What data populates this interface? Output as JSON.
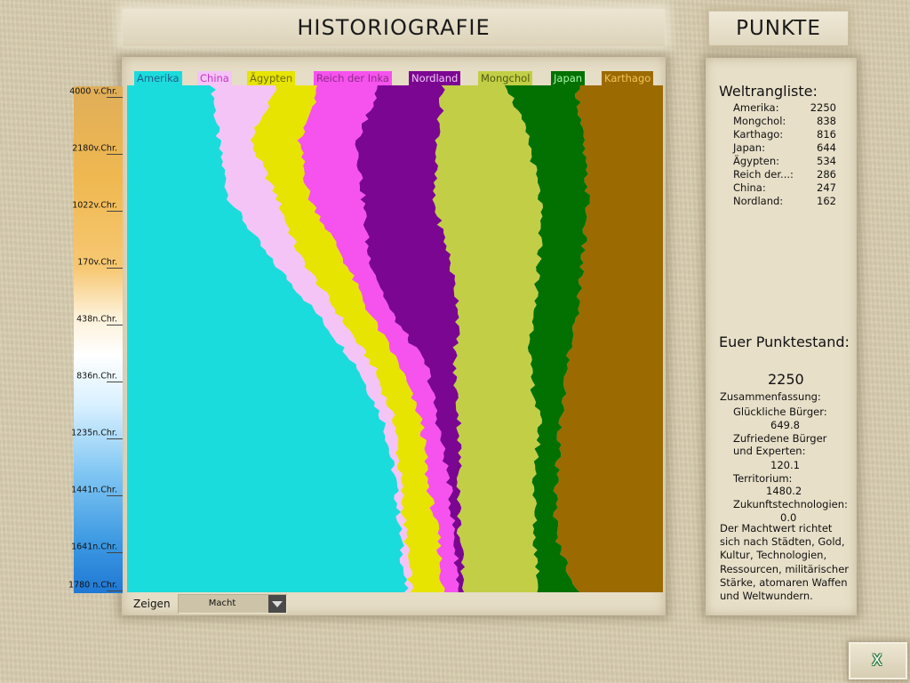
{
  "header": {
    "title": "HISTORIOGRAFIE",
    "tab_label": "PUNKTE"
  },
  "timeline": {
    "labels": [
      "4000 v.Chr.",
      "2180v.Chr.",
      "1022v.Chr.",
      "170v.Chr.",
      "438n.Chr.",
      "836n.Chr.",
      "1235n.Chr.",
      "1441n.Chr.",
      "1641n.Chr.",
      "1780 n.Chr."
    ]
  },
  "chart_data": {
    "type": "area",
    "stacked": "normalized",
    "x_axis_orientation": "vertical, time runs top to bottom",
    "time_labels": [
      "4000 v.Chr.",
      "2180v.Chr.",
      "1022v.Chr.",
      "170v.Chr.",
      "438n.Chr.",
      "836n.Chr.",
      "1235n.Chr.",
      "1441n.Chr.",
      "1641n.Chr.",
      "1780 n.Chr."
    ],
    "series": [
      {
        "name": "Amerika",
        "color": "#1bdcdc",
        "boundary_right": [
          0.16,
          0.17,
          0.19,
          0.26,
          0.35,
          0.43,
          0.48,
          0.5,
          0.51,
          0.52
        ]
      },
      {
        "name": "China",
        "color": "#f4c4f7",
        "boundary_right": [
          0.28,
          0.23,
          0.28,
          0.32,
          0.39,
          0.46,
          0.5,
          0.51,
          0.52,
          0.53
        ]
      },
      {
        "name": "Ägypten",
        "color": "#e7e402",
        "boundary_right": [
          0.36,
          0.32,
          0.34,
          0.4,
          0.45,
          0.51,
          0.55,
          0.56,
          0.58,
          0.59
        ]
      },
      {
        "name": "Reich der Inka",
        "color": "#f652ee",
        "boundary_right": [
          0.47,
          0.43,
          0.44,
          0.45,
          0.49,
          0.56,
          0.58,
          0.6,
          0.61,
          0.62
        ]
      },
      {
        "name": "Nordland",
        "color": "#7b0692",
        "boundary_right": [
          0.59,
          0.58,
          0.57,
          0.6,
          0.62,
          0.61,
          0.62,
          0.62,
          0.62,
          0.63
        ]
      },
      {
        "name": "Mongchol",
        "color": "#c2cf46",
        "boundary_right": [
          0.71,
          0.75,
          0.77,
          0.77,
          0.76,
          0.75,
          0.77,
          0.76,
          0.76,
          0.77
        ]
      },
      {
        "name": "Japan",
        "color": "#027102",
        "boundary_right": [
          0.84,
          0.85,
          0.86,
          0.85,
          0.84,
          0.82,
          0.81,
          0.8,
          0.8,
          0.84
        ]
      },
      {
        "name": "Karthago",
        "color": "#9b6b02",
        "boundary_right": [
          1,
          1,
          1,
          1,
          1,
          1,
          1,
          1,
          1,
          1
        ]
      }
    ]
  },
  "legend": [
    {
      "label": "Amerika",
      "bg": "#1bdcdc",
      "fg": "#1f5f8f"
    },
    {
      "label": "China",
      "bg": "#f4c4f7",
      "fg": "#c535c4"
    },
    {
      "label": "Ägypten",
      "bg": "#e7e402",
      "fg": "#6d6b00"
    },
    {
      "label": "Reich der Inka",
      "bg": "#f652ee",
      "fg": "#8e2a8a"
    },
    {
      "label": "Nordland",
      "bg": "#7b0692",
      "fg": "#f2c8f8"
    },
    {
      "label": "Mongchol",
      "bg": "#c2cf46",
      "fg": "#4f5a10"
    },
    {
      "label": "Japan",
      "bg": "#027102",
      "fg": "#a9f5a9"
    },
    {
      "label": "Karthago",
      "bg": "#9b6b02",
      "fg": "#f2c55a"
    }
  ],
  "controls": {
    "zeigen_label": "Zeigen",
    "zeigen_value": "Macht"
  },
  "ranking": {
    "title": "Weltrangliste:",
    "rows": [
      {
        "name": "Amerika:",
        "value": "2250"
      },
      {
        "name": "Mongchol:",
        "value": "838"
      },
      {
        "name": "Karthago:",
        "value": "816"
      },
      {
        "name": "Japan:",
        "value": "644"
      },
      {
        "name": "Ägypten:",
        "value": "534"
      },
      {
        "name": "Reich der...:",
        "value": "286"
      },
      {
        "name": "China:",
        "value": "247"
      },
      {
        "name": "Nordland:",
        "value": "162"
      }
    ]
  },
  "score": {
    "title": "Euer Punktestand:",
    "value": "2250",
    "summary_title": "Zusammenfassung:",
    "happy_label": "Glückliche Bürger:",
    "happy_value": "649.8",
    "content_label_1": "Zufriedene Bürger",
    "content_label_2": "und Experten:",
    "content_value": "120.1",
    "territory_label": "Territorium:",
    "territory_value": "1480.2",
    "future_label": "Zukunftstechnologien:",
    "future_value": "0.0",
    "note": "Der Machtwert richtet sich nach Städten, Gold, Kultur, Technologien, Ressourcen, militärischer Stärke, atomaren Waffen und Weltwundern."
  },
  "close_button": {
    "glyph": "X",
    "icon": "hourglass-close-icon"
  }
}
